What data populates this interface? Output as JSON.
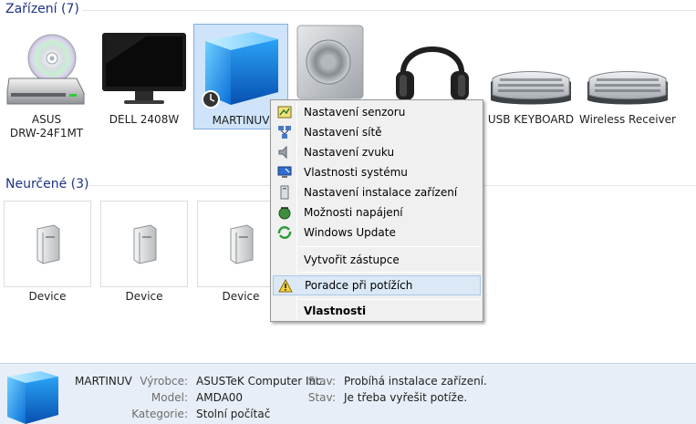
{
  "groups": {
    "devices_header": "Zařízení (7)",
    "unspecified_header": "Neurčené (3)"
  },
  "devices": [
    {
      "label": "ASUS\nDRW-24F1MT",
      "icon": "optical-drive-icon"
    },
    {
      "label": "DELL 2408W",
      "icon": "monitor-icon"
    },
    {
      "label": "MARTINUV",
      "icon": "computer-cube-icon",
      "selected": true
    },
    {
      "label": "",
      "icon": "speaker-icon"
    },
    {
      "label": "",
      "icon": "headphones-icon"
    },
    {
      "label": "USB KEYBOARD",
      "icon": "keyboard-icon"
    },
    {
      "label": "Wireless Receiver",
      "icon": "keyboard-icon"
    }
  ],
  "device_labels": {
    "asus_line1": "ASUS",
    "asus_line2": "DRW-24F1MT",
    "dell": "DELL 2408W",
    "martinuv": "MARTINUV",
    "usb_keyboard": "USB KEYBOARD",
    "wireless": "Wireless Receiver"
  },
  "unspecified": [
    {
      "label": "Device",
      "icon": "generic-device-icon"
    },
    {
      "label": "Device",
      "icon": "generic-device-icon"
    },
    {
      "label": "Device",
      "icon": "generic-device-icon"
    }
  ],
  "context_menu": {
    "items": [
      {
        "label": "Nastavení senzoru",
        "icon": "sensor-settings-icon"
      },
      {
        "label": "Nastavení sítě",
        "icon": "network-settings-icon"
      },
      {
        "label": "Nastavení zvuku",
        "icon": "sound-settings-icon"
      },
      {
        "label": "Vlastnosti systému",
        "icon": "system-properties-icon"
      },
      {
        "label": "Nastavení instalace zařízení",
        "icon": "device-installation-icon"
      },
      {
        "label": "Možnosti napájení",
        "icon": "power-options-icon"
      },
      {
        "label": "Windows Update",
        "icon": "windows-update-icon"
      },
      {
        "label": "Vytvořit zástupce",
        "icon": ""
      },
      {
        "label": "Poradce při potížích",
        "icon": "warning-icon",
        "highlighted": true
      },
      {
        "label": "Vlastnosti",
        "icon": "",
        "bold": true
      }
    ]
  },
  "details": {
    "name": "MARTINUV",
    "manufacturer_key": "Výrobce:",
    "manufacturer_val": "ASUSTeK Computer Inc.",
    "model_key": "Model:",
    "model_val": "AMDA00",
    "category_key": "Kategorie:",
    "category_val": "Stolní počítač",
    "status_key1": "Stav:",
    "status_val1": "Probíhá instalace zařízení.",
    "status_key2": "Stav:",
    "status_val2": "Je třeba vyřešit potíže."
  },
  "colors": {
    "header_text": "#1e3287",
    "selection_fill": "#cfe4fa",
    "selection_border": "#84acdd",
    "menu_highlight": "#dbe8f5",
    "details_bg": "#e8eef7"
  }
}
